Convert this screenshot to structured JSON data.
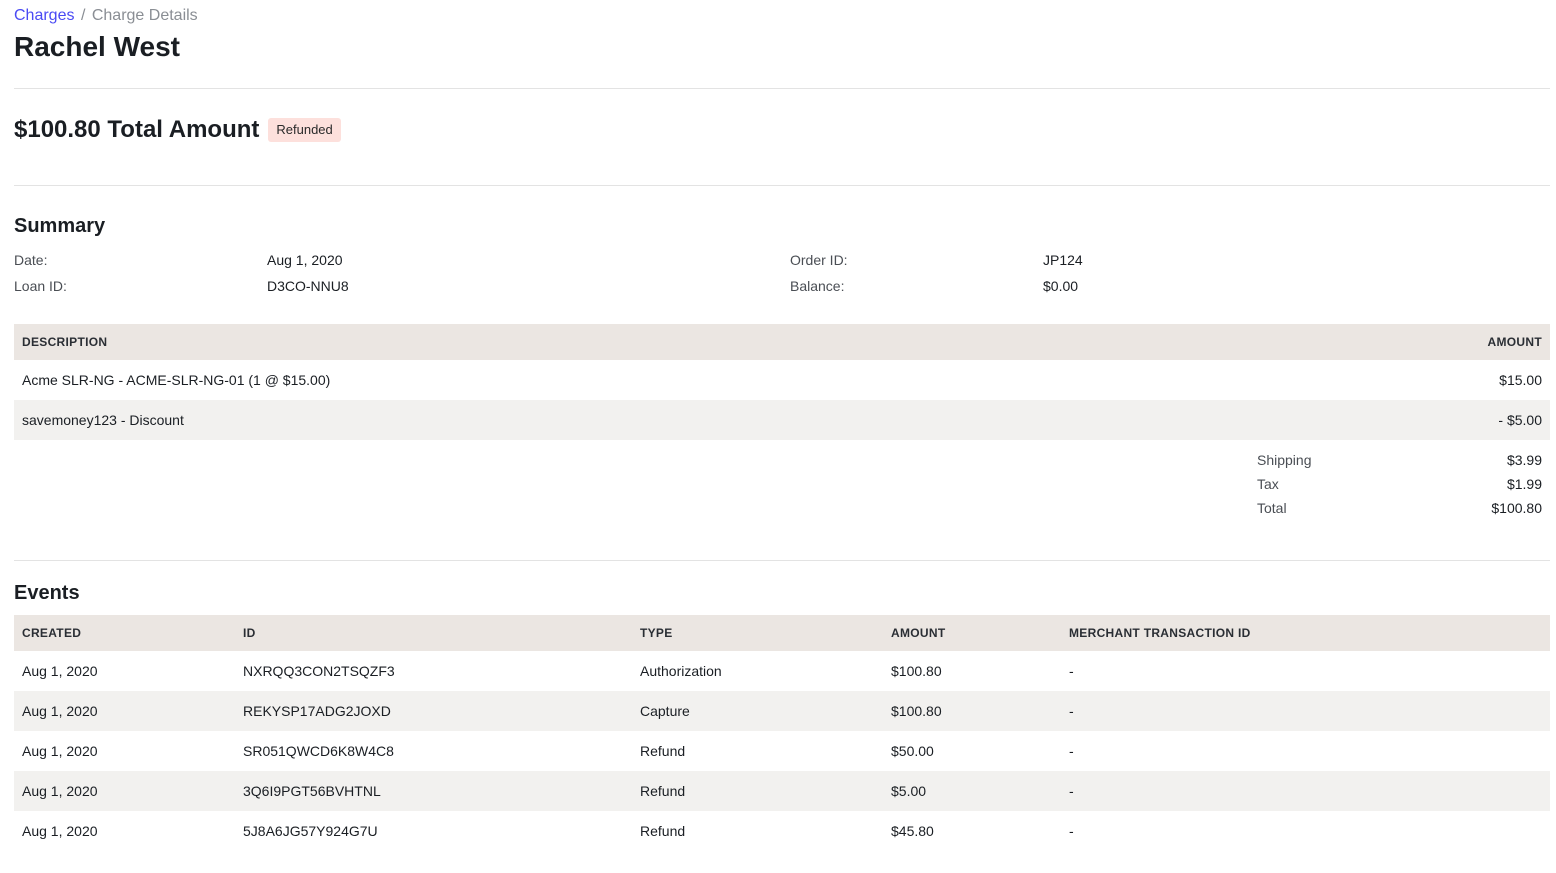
{
  "breadcrumb": {
    "parent": "Charges",
    "separator": "/",
    "current": "Charge Details"
  },
  "page_title": "Rachel West",
  "total": {
    "amount_text": "$100.80 Total Amount",
    "status": "Refunded"
  },
  "summary": {
    "title": "Summary",
    "date_label": "Date:",
    "date_value": "Aug 1, 2020",
    "order_label": "Order ID:",
    "order_value": "JP124",
    "loan_label": "Loan ID:",
    "loan_value": "D3CO-NNU8",
    "balance_label": "Balance:",
    "balance_value": "$0.00"
  },
  "items_table": {
    "headers": {
      "description": "DESCRIPTION",
      "amount": "AMOUNT"
    },
    "rows": [
      {
        "description": "Acme SLR-NG - ACME-SLR-NG-01 (1 @ $15.00)",
        "amount": "$15.00"
      },
      {
        "description": "savemoney123 - Discount",
        "amount": "- $5.00"
      }
    ],
    "totals": [
      {
        "label": "Shipping",
        "value": "$3.99"
      },
      {
        "label": "Tax",
        "value": "$1.99"
      },
      {
        "label": "Total",
        "value": "$100.80"
      }
    ]
  },
  "events": {
    "title": "Events",
    "headers": {
      "created": "CREATED",
      "id": "ID",
      "type": "TYPE",
      "amount": "AMOUNT",
      "merchant_txn": "MERCHANT TRANSACTION ID"
    },
    "rows": [
      {
        "created": "Aug 1, 2020",
        "id": "NXRQQ3CON2TSQZF3",
        "type": "Authorization",
        "amount": "$100.80",
        "merchant_txn": "-"
      },
      {
        "created": "Aug 1, 2020",
        "id": "REKYSP17ADG2JOXD",
        "type": "Capture",
        "amount": "$100.80",
        "merchant_txn": "-"
      },
      {
        "created": "Aug 1, 2020",
        "id": "SR051QWCD6K8W4C8",
        "type": "Refund",
        "amount": "$50.00",
        "merchant_txn": "-"
      },
      {
        "created": "Aug 1, 2020",
        "id": "3Q6I9PGT56BVHTNL",
        "type": "Refund",
        "amount": "$5.00",
        "merchant_txn": "-"
      },
      {
        "created": "Aug 1, 2020",
        "id": "5J8A6JG57Y924G7U",
        "type": "Refund",
        "amount": "$45.80",
        "merchant_txn": "-"
      }
    ]
  },
  "colors": {
    "link": "#4a4af4",
    "badge_bg": "#fde0dc",
    "header_bg": "#ebe6e2",
    "alt_row_bg": "#f2f1ef"
  }
}
